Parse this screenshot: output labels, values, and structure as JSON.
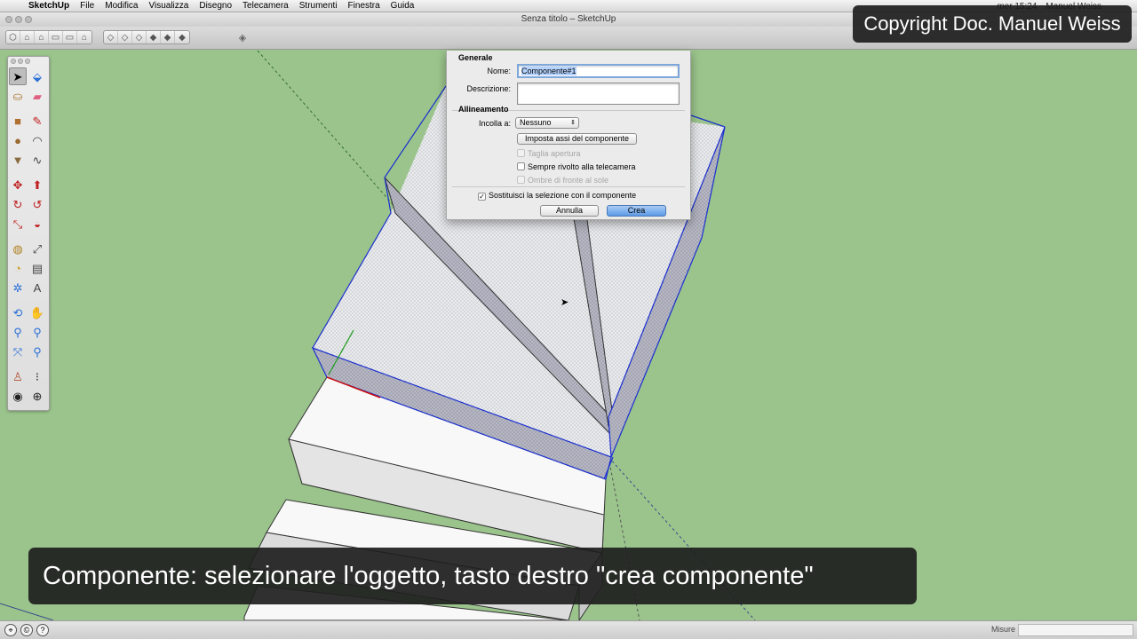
{
  "menubar": {
    "app_name": "SketchUp",
    "items": [
      "File",
      "Modifica",
      "Visualizza",
      "Disegno",
      "Telecamera",
      "Strumenti",
      "Finestra",
      "Guida"
    ],
    "clock": "mer 15:24",
    "user": "Manuel Weiss"
  },
  "window": {
    "title": "Senza titolo – SketchUp"
  },
  "toolbar": {
    "view_icons_1": [
      "iso-view-icon",
      "top-view-icon",
      "front-view-icon",
      "right-view-icon",
      "back-view-icon",
      "left-view-icon"
    ],
    "view_icons_2": [
      "xray-icon",
      "wireframe-icon",
      "hidden-line-icon",
      "shaded-icon",
      "shaded-textures-icon",
      "monochrome-icon"
    ]
  },
  "watermark": {
    "text": "Copyright Doc. Manuel Weiss"
  },
  "tool_palette": [
    [
      "select-icon",
      "component-icon"
    ],
    [
      "paint-bucket-icon",
      "eraser-icon"
    ],
    [
      "rectangle-icon",
      "line-icon"
    ],
    [
      "circle-icon",
      "arc-icon"
    ],
    [
      "polygon-icon",
      "freehand-icon"
    ],
    [
      "move-icon",
      "push-pull-icon"
    ],
    [
      "rotate-icon",
      "follow-me-icon"
    ],
    [
      "scale-icon",
      "offset-icon"
    ],
    [
      "tape-measure-icon",
      "dimension-icon"
    ],
    [
      "protractor-icon",
      "text-icon"
    ],
    [
      "axes-icon",
      "3d-text-icon"
    ],
    [
      "orbit-icon",
      "pan-icon"
    ],
    [
      "zoom-icon",
      "zoom-window-icon"
    ],
    [
      "zoom-extents-icon",
      "previous-view-icon"
    ],
    [
      "position-camera-icon",
      "walk-icon"
    ],
    [
      "look-around-icon",
      "section-plane-icon"
    ]
  ],
  "dialog": {
    "general_title": "Generale",
    "name_label": "Nome:",
    "name_value": "Componente#1",
    "description_label": "Descrizione:",
    "description_value": "",
    "alignment_title": "Allineamento",
    "glue_label": "Incolla a:",
    "glue_value": "Nessuno",
    "set_axes_button": "Imposta assi del componente",
    "cut_opening": "Taglia apertura",
    "always_face_camera": "Sempre rivolto alla telecamera",
    "shadows_face_sun": "Ombre di fronte al sole",
    "replace_selection": "Sostituisci la selezione con il componente",
    "replace_selection_checked": true,
    "cancel_button": "Annulla",
    "create_button": "Crea"
  },
  "caption": {
    "text": "Componente: selezionare l'oggetto, tasto destro \"crea componente\""
  },
  "statusbar": {
    "icons": [
      "geo-location-icon",
      "credits-icon",
      "help-icon"
    ],
    "measures_label": "Misure",
    "measures_value": ""
  }
}
